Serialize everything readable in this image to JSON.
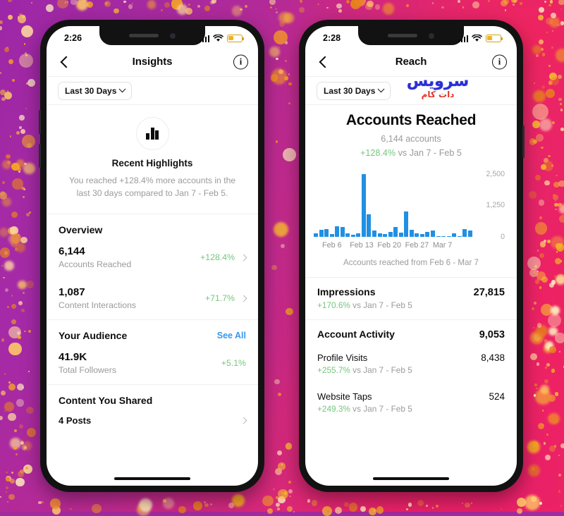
{
  "background": {
    "gradient_from": "#9c27a8",
    "gradient_to": "#f4245c",
    "confetti_color": "#f0a030"
  },
  "theme": {
    "accent_blue": "#3897f0",
    "bar_blue": "#2190e3",
    "positive_green": "#75c67c",
    "muted_gray": "#9b9b9b",
    "battery_yellow": "#f0b322"
  },
  "watermark": {
    "line1": "سرویس",
    "line2": "دات کام"
  },
  "left_phone": {
    "status_bar": {
      "time": "2:26",
      "cellular": "signal-bars",
      "wifi": "wifi-icon",
      "battery": "battery-low-icon"
    },
    "nav": {
      "back": "back-chevron",
      "title": "Insights",
      "info": "i"
    },
    "date_filter": {
      "label": "Last 30 Days",
      "chevron": "chevron-down-icon"
    },
    "highlights": {
      "icon": "bar-chart-icon",
      "title": "Recent Highlights",
      "description": "You reached +128.4% more accounts in the last 30 days compared to Jan 7 - Feb 5."
    },
    "overview": {
      "heading": "Overview",
      "rows": [
        {
          "value": "6,144",
          "label": "Accounts Reached",
          "delta": "+128.4%",
          "chevron": "chevron-right-icon"
        },
        {
          "value": "1,087",
          "label": "Content Interactions",
          "delta": "+71.7%",
          "chevron": "chevron-right-icon"
        }
      ]
    },
    "audience": {
      "heading": "Your Audience",
      "see_all": "See All",
      "rows": [
        {
          "value": "41.9K",
          "label": "Total Followers",
          "delta": "+5.1%"
        }
      ]
    },
    "content_shared": {
      "heading": "Content You Shared",
      "rows": [
        {
          "label": "4 Posts",
          "chevron": "chevron-right-icon"
        }
      ]
    }
  },
  "right_phone": {
    "status_bar": {
      "time": "2:28",
      "cellular": "signal-bars",
      "wifi": "wifi-icon",
      "battery": "battery-low-icon"
    },
    "nav": {
      "back": "back-chevron",
      "title": "Reach",
      "info": "i"
    },
    "date_filter": {
      "label": "Last 30 Days",
      "chevron": "chevron-down-icon"
    },
    "reach": {
      "title": "Accounts Reached",
      "subtitle": "6,144 accounts",
      "delta_value": "+128.4%",
      "delta_vs": " vs Jan 7 - Feb 5",
      "caption": "Accounts reached from Feb 6 - Mar 7"
    },
    "metrics": [
      {
        "name": "Impressions",
        "value": "27,815",
        "delta_value": "+170.6%",
        "delta_vs": " vs Jan 7 - Feb 5",
        "style": "main"
      },
      {
        "name": "Account Activity",
        "value": "9,053",
        "delta_value": "",
        "delta_vs": "",
        "style": "main"
      },
      {
        "name": "Profile Visits",
        "value": "8,438",
        "delta_value": "+255.7%",
        "delta_vs": " vs Jan 7 - Feb 5",
        "style": "sub"
      },
      {
        "name": "Website Taps",
        "value": "524",
        "delta_value": "+249.3%",
        "delta_vs": " vs Jan 7 - Feb 5",
        "style": "sub"
      }
    ]
  },
  "chart_data": {
    "type": "bar",
    "title": "Accounts Reached",
    "subtitle": "6,144 accounts",
    "annotation": "Accounts reached from Feb 6 - Mar 7",
    "xlabel": "",
    "ylabel": "",
    "ylim": [
      0,
      2750
    ],
    "yticks": [
      2500,
      1250,
      0
    ],
    "ytick_labels": [
      "2,500",
      "1,250",
      "0"
    ],
    "grid": false,
    "legend": false,
    "color": "#2190e3",
    "xtick_labels": [
      "Feb 6",
      "Feb 13",
      "Feb 20",
      "Feb 27",
      "Mar 7"
    ],
    "categories": [
      "Feb 6",
      "Feb 7",
      "Feb 8",
      "Feb 9",
      "Feb 10",
      "Feb 11",
      "Feb 12",
      "Feb 13",
      "Feb 14",
      "Feb 15",
      "Feb 16",
      "Feb 17",
      "Feb 18",
      "Feb 19",
      "Feb 20",
      "Feb 21",
      "Feb 22",
      "Feb 23",
      "Feb 24",
      "Feb 25",
      "Feb 26",
      "Feb 27",
      "Feb 28",
      "Mar 1",
      "Mar 2",
      "Mar 3",
      "Mar 4",
      "Mar 5",
      "Mar 6",
      "Mar 7"
    ],
    "values": [
      130,
      290,
      300,
      115,
      430,
      380,
      140,
      95,
      135,
      2500,
      900,
      240,
      150,
      110,
      200,
      380,
      160,
      1000,
      290,
      130,
      120,
      200,
      240,
      40,
      35,
      35,
      130,
      40,
      300,
      260
    ]
  }
}
